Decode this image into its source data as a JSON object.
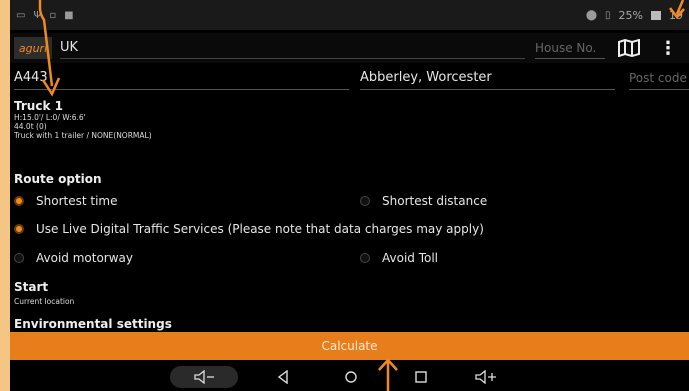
{
  "status": {
    "battery_text": "25%",
    "time_partial": "19"
  },
  "search": {
    "logo_text": "aguri",
    "country": "UK",
    "house_placeholder": "House No."
  },
  "address": {
    "street": "A443",
    "city": "Abberley, Worcester",
    "postcode_placeholder": "Post code"
  },
  "truck": {
    "title": "Truck 1",
    "dimensions": "H:15.0'/ L:0/ W:6.6'",
    "weight": "44.0t (0)",
    "trailer": "Truck with 1 trailer / NONE(NORMAL)"
  },
  "route": {
    "title": "Route option",
    "shortest_time": "Shortest time",
    "shortest_distance": "Shortest distance",
    "live_traffic": "Use Live Digital Traffic Services (Please note that data charges may apply)",
    "avoid_motorway": "Avoid motorway",
    "avoid_toll": "Avoid Toll"
  },
  "start": {
    "title": "Start",
    "value": "Current location"
  },
  "environment": {
    "title": "Environmental settings"
  },
  "calculate_label": "Calculate",
  "colors": {
    "accent": "#e87d1c",
    "frame": "#f5c683"
  }
}
